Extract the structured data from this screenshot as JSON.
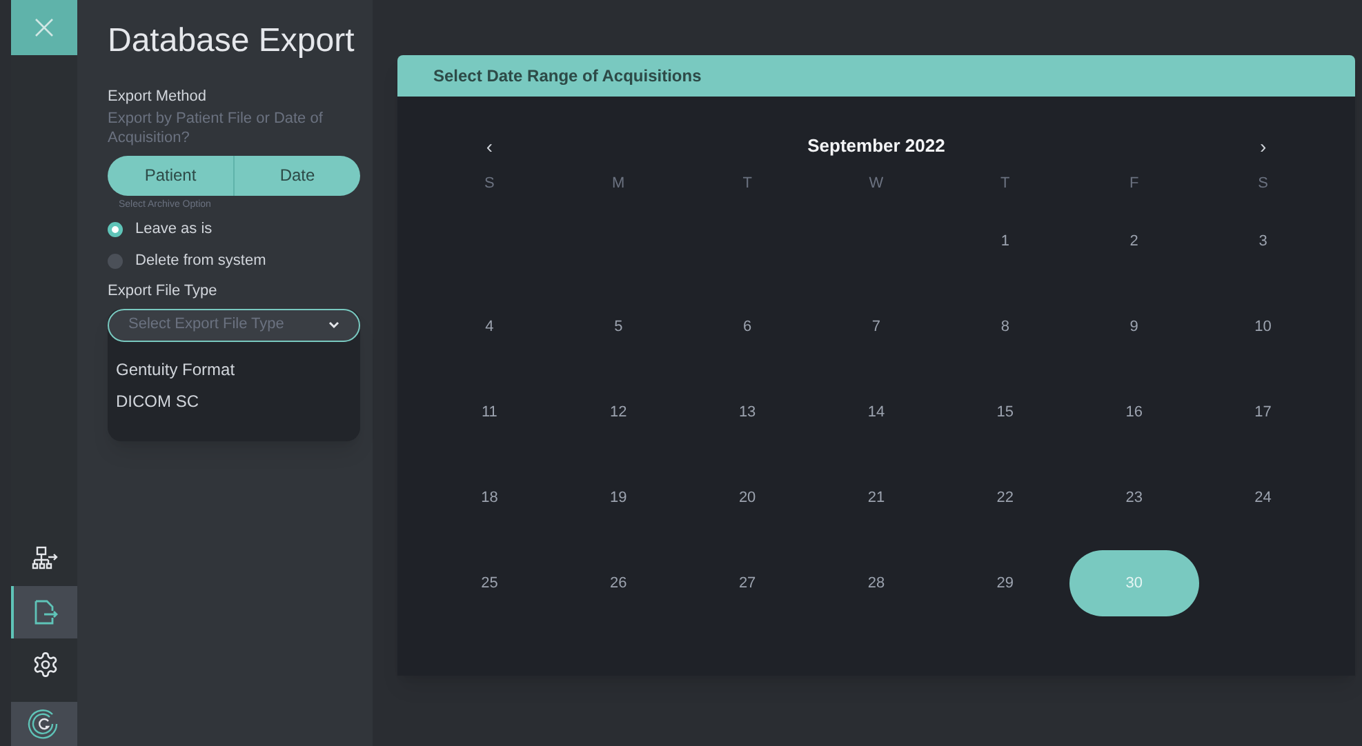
{
  "nav": [
    {
      "kind": "network",
      "selected": false
    },
    {
      "kind": "export",
      "selected": true
    },
    {
      "kind": "settings",
      "selected": false
    }
  ],
  "panel": {
    "title": "Database Export",
    "method_label": "Export Method",
    "method_question": "Export by Patient File or Date of Acquisition?",
    "method_options": [
      "Patient",
      "Date"
    ],
    "archive_label": "Select Archive Option",
    "archive_options": [
      {
        "label": "Leave as is",
        "selected": true
      },
      {
        "label": "Delete from system",
        "selected": false
      }
    ],
    "file_type_label": "Export File Type",
    "file_type_select": {
      "placeholder": "Select Export File Type",
      "options": [
        "Gentuity Format",
        "DICOM SC"
      ]
    }
  },
  "calendar": {
    "header": "Select Date Range of Acquisitions",
    "prev": "‹",
    "next": "›",
    "month": "September 2022",
    "weekdays": [
      "S",
      "M",
      "T",
      "W",
      "T",
      "F",
      "S"
    ],
    "days": [
      {
        "label": "1",
        "selected": false
      },
      {
        "label": "2",
        "selected": false
      },
      {
        "label": "3",
        "selected": false
      },
      {
        "label": "4",
        "selected": false
      },
      {
        "label": "5",
        "selected": false
      },
      {
        "label": "6",
        "selected": false
      },
      {
        "label": "7",
        "selected": false
      },
      {
        "label": "8",
        "selected": false
      },
      {
        "label": "9",
        "selected": false
      },
      {
        "label": "10",
        "selected": false
      },
      {
        "label": "11",
        "selected": false
      },
      {
        "label": "12",
        "selected": false
      },
      {
        "label": "13",
        "selected": false
      },
      {
        "label": "14",
        "selected": false
      },
      {
        "label": "15",
        "selected": false
      },
      {
        "label": "16",
        "selected": false
      },
      {
        "label": "17",
        "selected": false
      },
      {
        "label": "18",
        "selected": false
      },
      {
        "label": "19",
        "selected": false
      },
      {
        "label": "20",
        "selected": false
      },
      {
        "label": "21",
        "selected": false
      },
      {
        "label": "22",
        "selected": false
      },
      {
        "label": "23",
        "selected": false
      },
      {
        "label": "24",
        "selected": false
      },
      {
        "label": "25",
        "selected": false
      },
      {
        "label": "26",
        "selected": false
      },
      {
        "label": "27",
        "selected": false
      },
      {
        "label": "28",
        "selected": false
      },
      {
        "label": "29",
        "selected": false
      },
      {
        "label": "30",
        "selected": true
      }
    ]
  }
}
